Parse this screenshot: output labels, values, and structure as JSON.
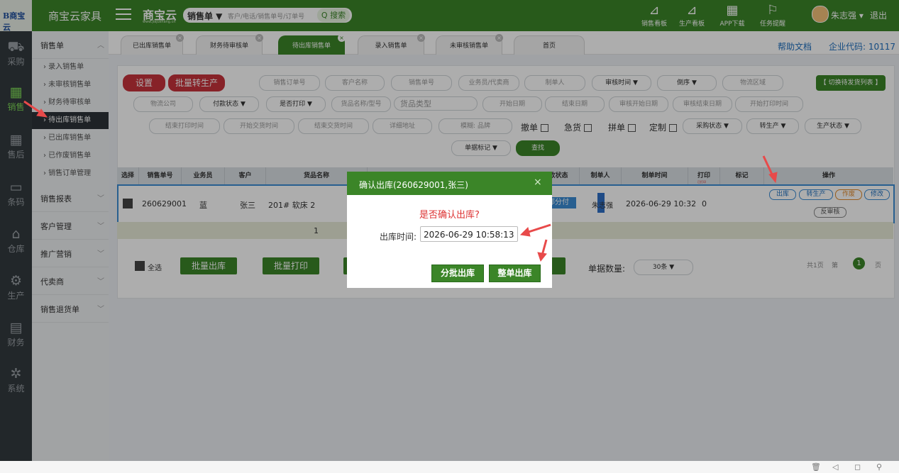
{
  "app": {
    "logo_text": "B商宝云",
    "title": "商宝云家具",
    "brand": "商宝云",
    "brand_sub": "www.jiajushang.cn"
  },
  "search": {
    "scope": "销售单 ▼",
    "placeholder": "客户/电话/销售单号/订单号",
    "button": "Q 搜索"
  },
  "top_nav": [
    {
      "icon": "chart-icon",
      "label": "销售看板"
    },
    {
      "icon": "chart-icon",
      "label": "生产看板"
    },
    {
      "icon": "qrcode-icon",
      "label": "APP下载"
    },
    {
      "icon": "flag-icon",
      "label": "任务提醒"
    }
  ],
  "user": {
    "name": "朱志强 ▾",
    "logout": "退出"
  },
  "icon_sidebar": [
    {
      "icon": "cart-icon",
      "label": "采购"
    },
    {
      "icon": "grid-icon",
      "label": "销售"
    },
    {
      "icon": "grid-icon",
      "label": "售后"
    },
    {
      "icon": "barcode-icon",
      "label": "条码"
    },
    {
      "icon": "warehouse-icon",
      "label": "仓库"
    },
    {
      "icon": "factory-icon",
      "label": "生产"
    },
    {
      "icon": "calculator-icon",
      "label": "财务"
    },
    {
      "icon": "gear-icon",
      "label": "系统"
    }
  ],
  "submenu": {
    "section": "销售单",
    "items": [
      "› 录入销售单",
      "› 未审核销售单",
      "› 财务待审核单",
      "› 待出库销售单",
      "› 已出库销售单",
      "› 已作废销售单",
      "› 销售订单管理"
    ],
    "groups": [
      "销售报表",
      "客户管理",
      "推广营销",
      "代卖商",
      "销售退货单"
    ]
  },
  "tabs": [
    "已出库销售单",
    "财务待审核单",
    "待出库销售单",
    "录入销售单",
    "未审核销售单",
    "首页"
  ],
  "help": "帮助文档",
  "company_code": "企业代码: 10117",
  "filters": {
    "settings": "设置",
    "batch_production": "批量转生产",
    "order_no": "销售订单号",
    "customer": "客户名称",
    "sales_no": "销售单号",
    "agent": "业务员/代卖商",
    "creator": "制单人",
    "audit_time": "审核时间 ▼",
    "sort": "倒序 ▼",
    "logistics_area": "物流区域",
    "switch": "【 切换待发货列表 】",
    "logistics_company": "物流公司",
    "pay_status": "付款状态 ▼",
    "printed": "是否打印 ▼",
    "goods_name": "货品名称/型号",
    "goods_type": "货品类型",
    "start_date": "开始日期",
    "end_date": "结束日期",
    "audit_start": "审核开始日期",
    "audit_end": "审核结束日期",
    "print_start": "开始打印时间",
    "print_end": "结束打印时间",
    "trade_start": "开始交货时间",
    "trade_end": "结束交货时间",
    "address": "详细地址",
    "fuzzy": "模糊: 品牌",
    "cancel_label": "撤单",
    "urgent_label": "急货",
    "combine_label": "拼单",
    "custom_label": "定制",
    "purchase_status": "采购状态 ▼",
    "to_production": "转生产 ▼",
    "production_status": "生产状态 ▼",
    "doc_mark": "单据标记 ▼",
    "search_btn": "查找"
  },
  "table": {
    "headers": [
      "选择",
      "销售单号",
      "业务员",
      "客户",
      "货品名称",
      "款状态",
      "制单人",
      "制单时间",
      "打印",
      "标记",
      "操作"
    ],
    "print_sub": "已打印",
    "row": {
      "sales_no": "260629001",
      "agent": "蓝",
      "customer": "张三",
      "goods": "201# 软床 2",
      "pay_status": "部分付",
      "creator": "朱志强",
      "time": "2026-06-29 10:32",
      "print": "0"
    },
    "ops": [
      "出库",
      "转生产",
      "作废",
      "修改",
      "反审核"
    ],
    "summary_count": "1"
  },
  "bottom": {
    "select_all": "全选",
    "batch_out": "批量出库",
    "batch_print": "批量打印",
    "qty_label": "单据数量:",
    "qty_value": "30条 ▼",
    "pager_total": "共1页",
    "pager_first": "第",
    "pager_page": "1",
    "pager_unit": "页"
  },
  "dialog": {
    "title": "确认出库(260629001,张三)",
    "close": "×",
    "message": "是否确认出库?",
    "time_label": "出库时间:",
    "time_value": "2026-06-29 10:58:13",
    "btn_partial": "分批出库",
    "btn_whole": "整单出库"
  },
  "colors": {
    "primary": "#3b8528",
    "danger": "#c8333b",
    "link": "#1e6fbf",
    "arrow": "#e84a4a"
  }
}
